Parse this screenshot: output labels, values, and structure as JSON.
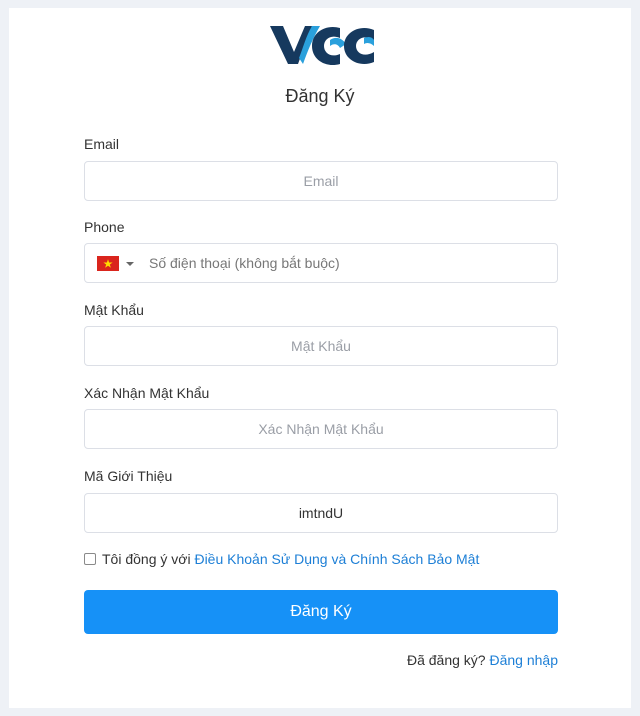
{
  "brand": {
    "logo_name": "VCC",
    "colors": {
      "navy": "#16395e",
      "blue": "#2aa0dc",
      "accent": "#1691f7",
      "link": "#1d7fd6"
    }
  },
  "form": {
    "title": "Đăng Ký",
    "email": {
      "label": "Email",
      "placeholder": "Email",
      "value": ""
    },
    "phone": {
      "label": "Phone",
      "country_flag": "vietnam-flag-icon",
      "placeholder": "Số điện thoại (không bắt buộc)",
      "value": ""
    },
    "password": {
      "label": "Mật Khẩu",
      "placeholder": "Mật Khẩu",
      "value": ""
    },
    "confirm_password": {
      "label": "Xác Nhận Mật Khẩu",
      "placeholder": "Xác Nhận Mật Khẩu",
      "value": ""
    },
    "referral": {
      "label": "Mã Giới Thiệu",
      "value": "imtndU"
    },
    "agree": {
      "prefix": "Tôi đồng ý với ",
      "link_text": "Điều Khoản Sử Dụng và Chính Sách Bảo Mật",
      "checked": false
    },
    "submit_label": "Đăng Ký",
    "login_prompt": "Đã đăng ký? ",
    "login_link": "Đăng nhập"
  }
}
